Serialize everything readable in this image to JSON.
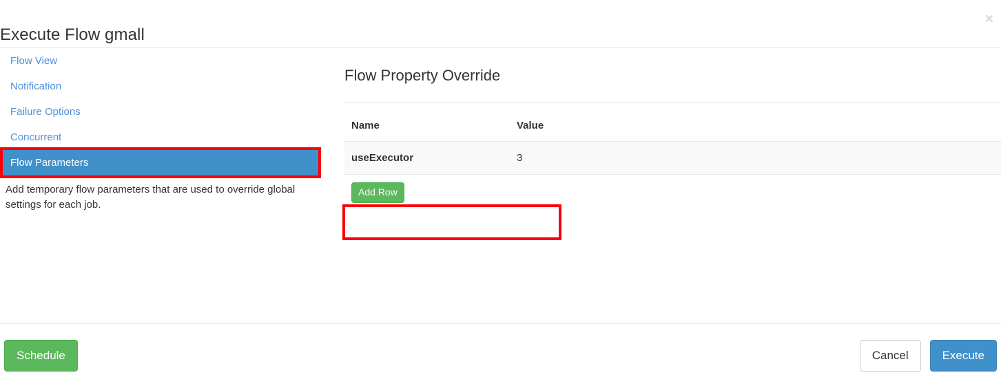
{
  "header": {
    "title": "Execute Flow gmall",
    "close_label": "×",
    "close_icon": "close-icon"
  },
  "sidebar": {
    "items": [
      {
        "label": "Flow View",
        "active": false,
        "highlighted": false
      },
      {
        "label": "Notification",
        "active": false,
        "highlighted": false
      },
      {
        "label": "Failure Options",
        "active": false,
        "highlighted": false
      },
      {
        "label": "Concurrent",
        "active": false,
        "highlighted": false
      },
      {
        "label": "Flow Parameters",
        "active": true,
        "highlighted": true
      }
    ],
    "description": "Add temporary flow parameters that are used to override global settings for each job."
  },
  "main": {
    "panel_title": "Flow Property Override",
    "table": {
      "columns": [
        "Name",
        "Value",
        ""
      ],
      "rows": [
        {
          "name": "useExecutor",
          "value": "3",
          "extra": "",
          "highlighted": true
        }
      ]
    },
    "add_row_label": "Add Row"
  },
  "footer": {
    "schedule_label": "Schedule",
    "cancel_label": "Cancel",
    "execute_label": "Execute"
  },
  "colors": {
    "link_blue": "#4a90d9",
    "active_blue": "#4090ca",
    "primary_blue": "#4090ca",
    "success_green": "#5cb85c",
    "annotation_red": "#fb0007",
    "row_grey": "#f9f9f9",
    "border_grey": "#e5e5e5",
    "text_dark": "#333333",
    "close_grey": "#d8d8d8"
  }
}
